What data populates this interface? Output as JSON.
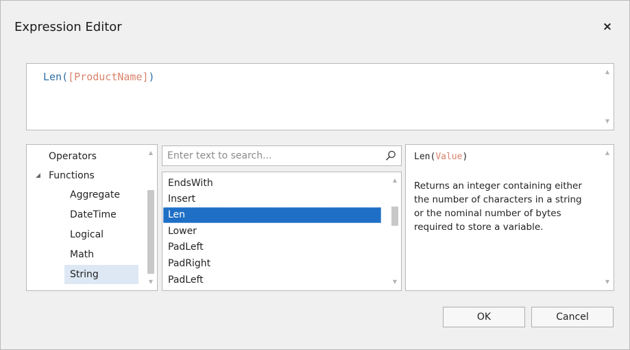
{
  "window": {
    "title": "Expression Editor",
    "close_label": "×"
  },
  "expression": {
    "function_name": "Len",
    "open_paren": "(",
    "field": "[ProductName]",
    "close_paren": ")"
  },
  "categories": {
    "items": [
      {
        "label": "Operators",
        "level": 0
      },
      {
        "label": "Functions",
        "level": 0,
        "expanded": true
      },
      {
        "label": "Aggregate",
        "level": 1
      },
      {
        "label": "DateTime",
        "level": 1
      },
      {
        "label": "Logical",
        "level": 1
      },
      {
        "label": "Math",
        "level": 1
      },
      {
        "label": "String",
        "level": 1,
        "selected": true
      }
    ]
  },
  "search": {
    "placeholder": "Enter text to search...",
    "value": ""
  },
  "functions": {
    "items": [
      "EndsWith",
      "Insert",
      "Len",
      "Lower",
      "PadLeft",
      "PadRight",
      "PadLeft"
    ],
    "selected": "Len"
  },
  "description": {
    "signature_name": "Len",
    "signature_open": "(",
    "signature_param": "Value",
    "signature_close": ")",
    "text": "Returns an integer containing either the number of characters in a string or the nominal number of bytes required to store a variable."
  },
  "buttons": {
    "ok": "OK",
    "cancel": "Cancel"
  },
  "colors": {
    "selection": "#1f6fc6",
    "tree_selection": "#dde8f4",
    "keyword": "#2e6da4",
    "field": "#d9826a"
  },
  "icons": {
    "search": "search-icon",
    "collapse": "collapse-triangle-icon",
    "scroll_up": "scroll-up-icon",
    "scroll_down": "scroll-down-icon",
    "close": "close-icon"
  }
}
